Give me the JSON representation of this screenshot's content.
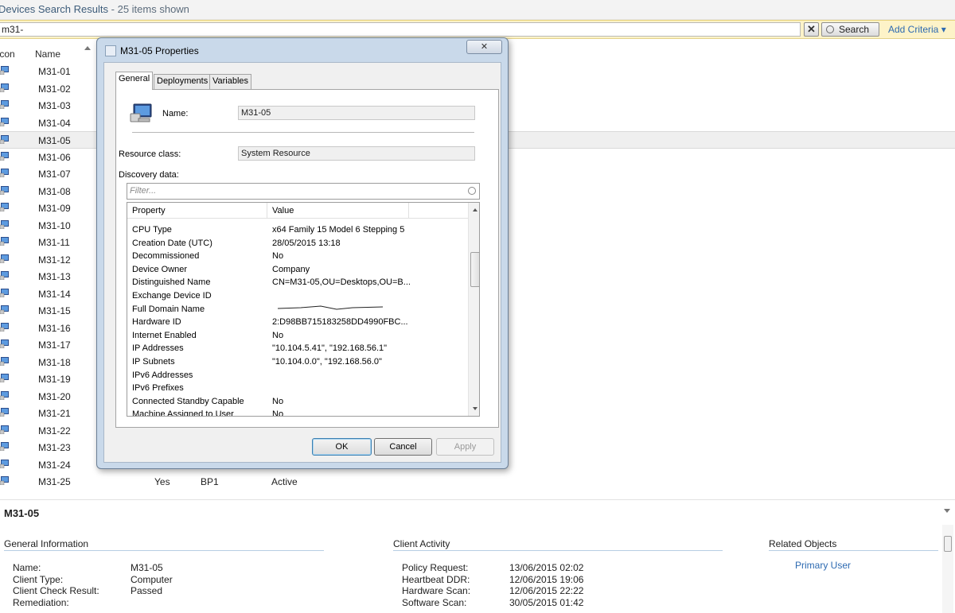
{
  "header": {
    "title": "Devices Search Results",
    "count": "25 items shown",
    "separator": "-"
  },
  "search": {
    "query": "m31-",
    "clear_label": "✕",
    "search_label": "Search",
    "add_criteria_label": "Add Criteria ▾"
  },
  "columns": {
    "icon": "Icon",
    "name": "Name"
  },
  "devices": [
    {
      "name": "M31-01"
    },
    {
      "name": "M31-02"
    },
    {
      "name": "M31-03"
    },
    {
      "name": "M31-04"
    },
    {
      "name": "M31-05"
    },
    {
      "name": "M31-06"
    },
    {
      "name": "M31-07"
    },
    {
      "name": "M31-08"
    },
    {
      "name": "M31-09"
    },
    {
      "name": "M31-10"
    },
    {
      "name": "M31-11"
    },
    {
      "name": "M31-12"
    },
    {
      "name": "M31-13"
    },
    {
      "name": "M31-14"
    },
    {
      "name": "M31-15"
    },
    {
      "name": "M31-16"
    },
    {
      "name": "M31-17"
    },
    {
      "name": "M31-18"
    },
    {
      "name": "M31-19"
    },
    {
      "name": "M31-20"
    },
    {
      "name": "M31-21"
    },
    {
      "name": "M31-22"
    },
    {
      "name": "M31-23"
    },
    {
      "name": "M31-24"
    },
    {
      "name": "M31-25"
    }
  ],
  "selected_index": 4,
  "last_row": {
    "client": "Yes",
    "site": "BP1",
    "activity": "Active"
  },
  "dialog": {
    "title": "M31-05 Properties",
    "close_label": "✕",
    "tabs": [
      "General",
      "Deployments",
      "Variables"
    ],
    "name_label": "Name:",
    "name_value": "M31-05",
    "resource_class_label": "Resource class:",
    "resource_class_value": "System Resource",
    "discovery_label": "Discovery data:",
    "filter_placeholder": "Filter...",
    "grid_headers": {
      "property": "Property",
      "value": "Value"
    },
    "properties": [
      {
        "p": "CPU Type",
        "v": "x64 Family 15 Model 6 Stepping 5"
      },
      {
        "p": "Creation Date (UTC)",
        "v": "28/05/2015 13:18"
      },
      {
        "p": "Decommissioned",
        "v": "No"
      },
      {
        "p": "Device Owner",
        "v": "Company"
      },
      {
        "p": "Distinguished Name",
        "v": "CN=M31-05,OU=Desktops,OU=B..."
      },
      {
        "p": "Exchange Device ID",
        "v": ""
      },
      {
        "p": "Full Domain Name",
        "v": ""
      },
      {
        "p": "Hardware ID",
        "v": "2:D98BB715183258DD4990FBC..."
      },
      {
        "p": "Internet Enabled",
        "v": "No"
      },
      {
        "p": "IP Addresses",
        "v": "\"10.104.5.41\", \"192.168.56.1\""
      },
      {
        "p": "IP Subnets",
        "v": "\"10.104.0.0\", \"192.168.56.0\""
      },
      {
        "p": "IPv6 Addresses",
        "v": ""
      },
      {
        "p": "IPv6 Prefixes",
        "v": ""
      },
      {
        "p": "Connected Standby Capable",
        "v": "No"
      },
      {
        "p": "Machine Assigned to User",
        "v": "No"
      }
    ],
    "ok_label": "OK",
    "cancel_label": "Cancel",
    "apply_label": "Apply"
  },
  "details": {
    "title": "M31-05",
    "general": {
      "heading": "General Information",
      "rows": [
        {
          "k": "Name:",
          "v": "M31-05"
        },
        {
          "k": "Client Type:",
          "v": "Computer"
        },
        {
          "k": "Client Check Result:",
          "v": "Passed"
        },
        {
          "k": "Remediation:",
          "v": ""
        }
      ]
    },
    "activity": {
      "heading": "Client Activity",
      "rows": [
        {
          "k": "Policy Request:",
          "v": "13/06/2015 02:02"
        },
        {
          "k": "Heartbeat DDR:",
          "v": "12/06/2015 19:06"
        },
        {
          "k": "Hardware Scan:",
          "v": "12/06/2015 22:22"
        },
        {
          "k": "Software Scan:",
          "v": "30/05/2015 01:42"
        }
      ]
    },
    "related": {
      "heading": "Related Objects",
      "primary_user": "Primary User"
    }
  },
  "colors": {
    "link": "#2d6ab1",
    "search_bar": "#fdf3c8",
    "dialog_frame": "#c9d9ea"
  },
  "icons": {
    "device": "computer-icon",
    "search": "search-icon",
    "close": "close-icon"
  }
}
